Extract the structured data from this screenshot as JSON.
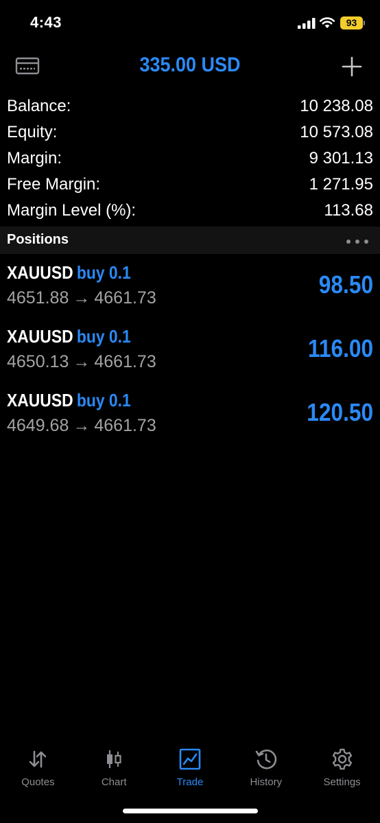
{
  "status_bar": {
    "time": "4:43",
    "battery": "93"
  },
  "header": {
    "title": "335.00 USD",
    "icons": {
      "left": "credit-card-icon",
      "right": "plus-icon"
    }
  },
  "summary": [
    {
      "label": "Balance:",
      "value": "10 238.08"
    },
    {
      "label": "Equity:",
      "value": "10 573.08"
    },
    {
      "label": "Margin:",
      "value": "9 301.13"
    },
    {
      "label": "Free Margin:",
      "value": "1 271.95"
    },
    {
      "label": "Margin Level (%):",
      "value": "113.68"
    }
  ],
  "positions": {
    "title": "Positions",
    "items": [
      {
        "symbol": "XAUUSD",
        "side": "buy 0.1",
        "open_price": "4651.88",
        "arrow": "→",
        "current_price": "4661.73",
        "profit": "98.50"
      },
      {
        "symbol": "XAUUSD",
        "side": "buy 0.1",
        "open_price": "4650.13",
        "arrow": "→",
        "current_price": "4661.73",
        "profit": "116.00"
      },
      {
        "symbol": "XAUUSD",
        "side": "buy 0.1",
        "open_price": "4649.68",
        "arrow": "→",
        "current_price": "4661.73",
        "profit": "120.50"
      }
    ]
  },
  "tabs": [
    {
      "label": "Quotes",
      "icon": "quotes-arrows-icon",
      "active": false
    },
    {
      "label": "Chart",
      "icon": "candlestick-chart-icon",
      "active": false
    },
    {
      "label": "Trade",
      "icon": "trade-chart-icon",
      "active": true
    },
    {
      "label": "History",
      "icon": "history-clock-icon",
      "active": false
    },
    {
      "label": "Settings",
      "icon": "gear-icon",
      "active": false
    }
  ],
  "colors": {
    "accent": "#2a8af6",
    "background": "#000000",
    "secondary_text": "#a3a3a3",
    "battery": "#f2cd2b"
  }
}
